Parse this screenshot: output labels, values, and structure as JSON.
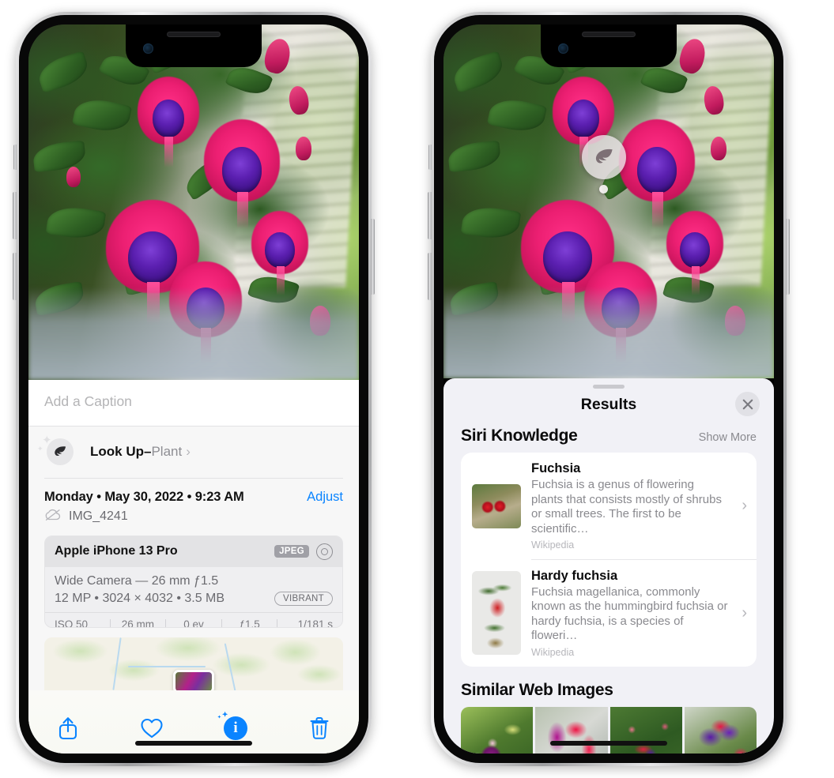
{
  "left_phone": {
    "caption_placeholder": "Add a Caption",
    "lookup": {
      "label": "Look Up",
      "dash": "–",
      "category": "Plant",
      "chevron": "›",
      "icon": "leaf-icon"
    },
    "date_line": "Monday • May 30, 2022 • 9:23 AM",
    "adjust_label": "Adjust",
    "file_name": "IMG_4241",
    "camera": {
      "model": "Apple iPhone 13 Pro",
      "format_badge": "JPEG",
      "lens_line": "Wide Camera — 26 mm ƒ1.5",
      "specs_line": "12 MP • 3024 × 4032 • 3.5 MB",
      "style_badge": "VIBRANT",
      "exif": [
        "ISO 50",
        "26 mm",
        "0 ev",
        "ƒ1.5",
        "1/181 s"
      ]
    },
    "toolbar": {
      "share_label": "share-icon",
      "favorite_label": "heart-icon",
      "info_label": "i",
      "delete_label": "trash-icon"
    }
  },
  "right_phone": {
    "badge_icon": "leaf-icon",
    "sheet": {
      "title": "Results",
      "close_label": "×"
    },
    "siri_knowledge": {
      "title": "Siri Knowledge",
      "action": "Show More",
      "items": [
        {
          "title": "Fuchsia",
          "description": "Fuchsia is a genus of flowering plants that consists mostly of shrubs or small trees. The first to be scientific…",
          "source": "Wikipedia",
          "chevron": "›"
        },
        {
          "title": "Hardy fuchsia",
          "description": "Fuchsia magellanica, commonly known as the hummingbird fuchsia or hardy fuchsia, is a species of floweri…",
          "source": "Wikipedia",
          "chevron": "›"
        }
      ]
    },
    "similar_web_images": {
      "title": "Similar Web Images",
      "thumbnails": [
        "fuchsia-web-image-1",
        "fuchsia-web-image-2",
        "fuchsia-web-image-3",
        "fuchsia-web-image-4"
      ]
    }
  },
  "colors": {
    "accent_blue": "#0a84ff",
    "sheet_bg": "#f1f1f6",
    "card_bg": "#ffffff",
    "secondary_text": "#8a8a8f"
  }
}
